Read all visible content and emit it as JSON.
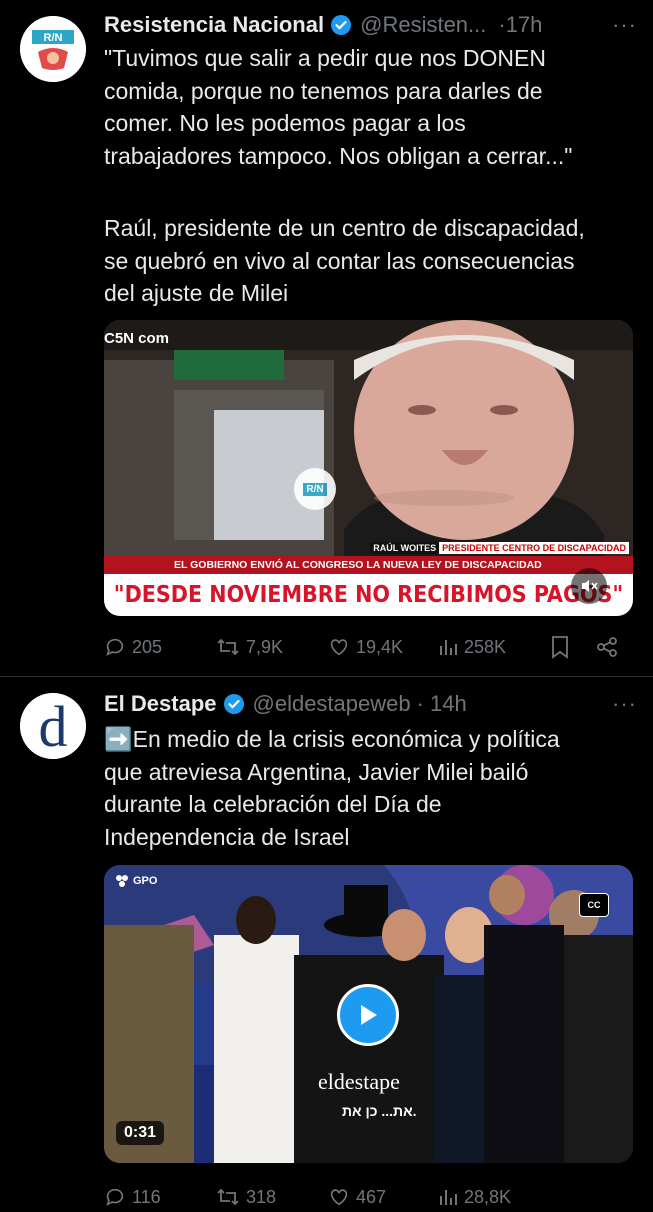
{
  "tweets": [
    {
      "name": "Resistencia Nacional",
      "handle": "@Resisten...",
      "time": "·17h",
      "avatar_text": "R/N",
      "text_quote": "\"Tuvimos que salir a pedir que nos DONEN\ncomida, porque no tenemos para darles de\ncomer. No les podemos pagar a los\ntrabajadores tampoco. Nos obligan a cerrar...\"",
      "text_body": "Raúl, presidente de un centro de discapacidad,\nse quebró en vivo al contar las consecuencias\ndel ajuste de Milei",
      "media": {
        "source_label": "C5N com",
        "name_tag": "RAÚL WOITES",
        "role_tag": "PRESIDENTE CENTRO DE DISCAPACIDAD",
        "subline": "EL GOBIERNO ENVIÓ AL CONGRESO LA NUEVA LEY DE DISCAPACIDAD",
        "headline": "\"DESDE NOVIEMBRE NO RECIBIMOS PAGOS\"",
        "watermark": "R/N"
      },
      "actions": {
        "replies": "205",
        "reposts": "7,9K",
        "likes": "19,4K",
        "views": "258K"
      }
    },
    {
      "name": "El Destape",
      "handle": "@eldestapeweb",
      "time": "· 14h",
      "avatar_text": "d",
      "text": "➡️En medio de la crisis económica y política\nque atreviesa Argentina, Javier Milei bailó\ndurante la celebración del Día de\nIndependencia de Israel",
      "media": {
        "gpo_label": "GPO",
        "cc_label": "CC",
        "watermark": "eldestape",
        "hebrew_caption": "את... כן את.",
        "duration": "0:31"
      },
      "actions": {
        "replies": "116",
        "reposts": "318",
        "likes": "467",
        "views": "28,8K"
      }
    }
  ],
  "colors": {
    "verified": "#1d9bf0",
    "muted": "#71767b",
    "headline_red": "#d8142a"
  }
}
